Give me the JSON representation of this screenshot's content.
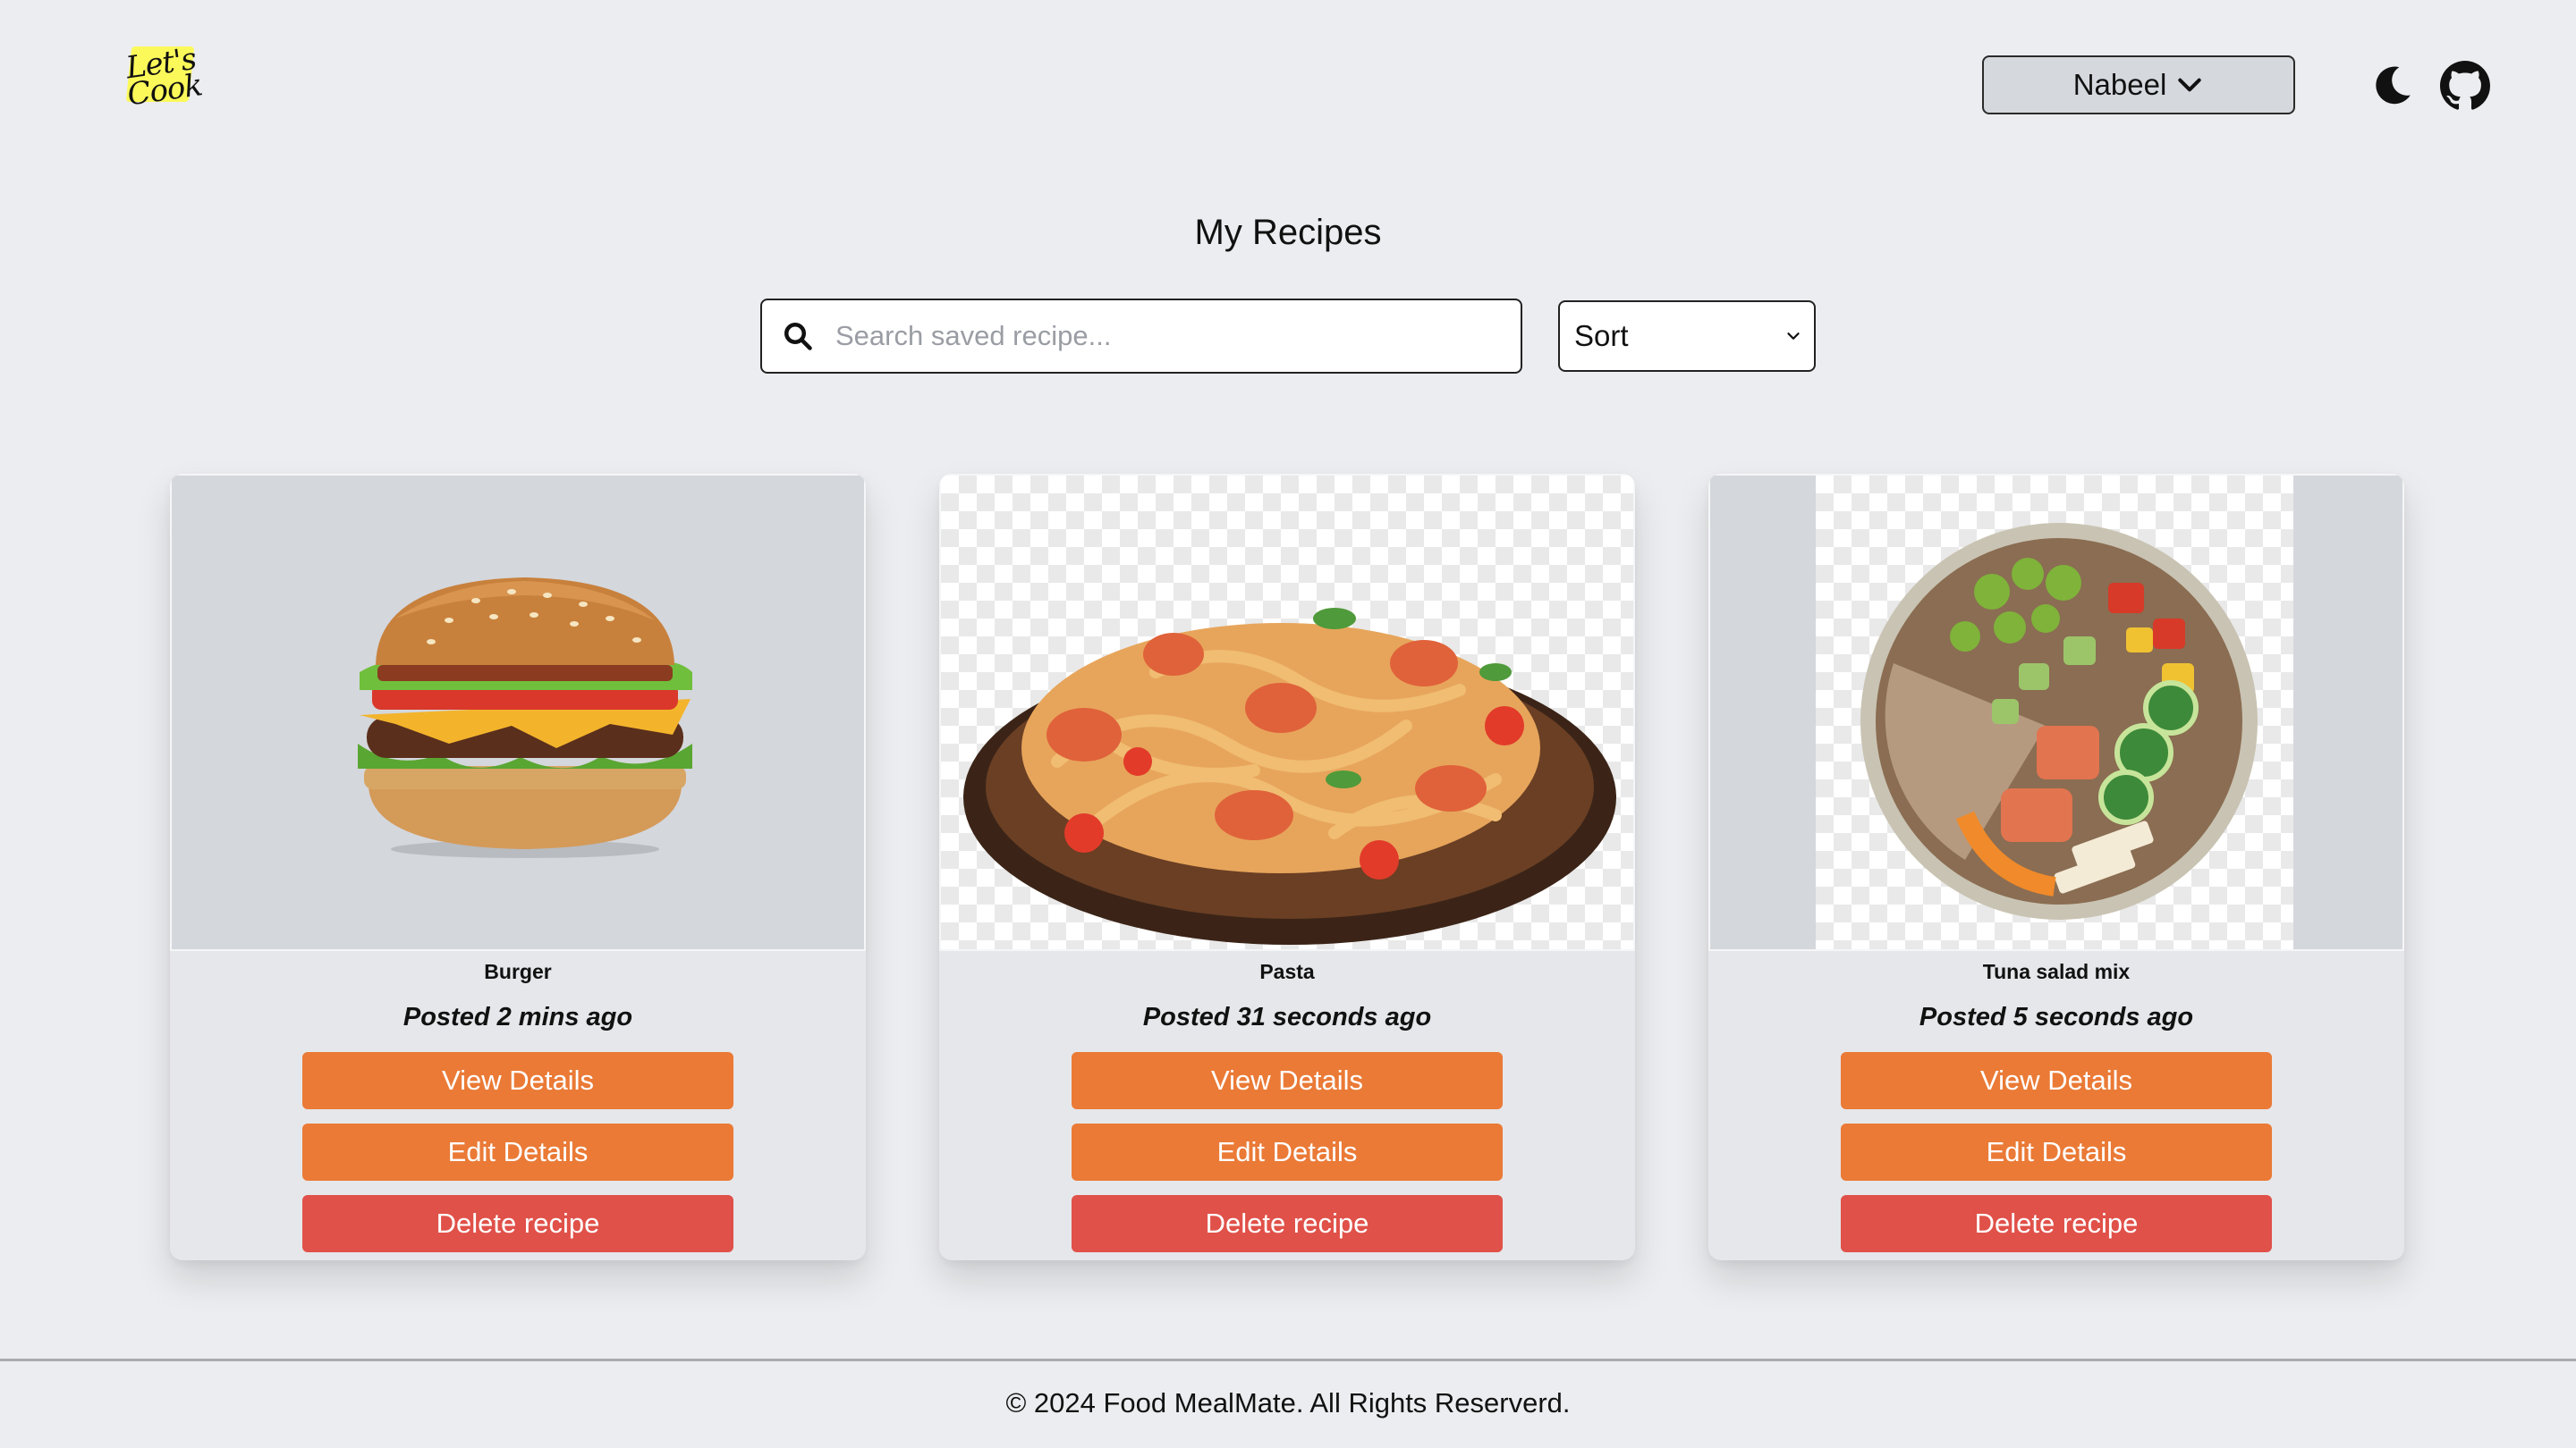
{
  "header": {
    "logo_text": "Let's Cook",
    "user_name": "Nabeel"
  },
  "main": {
    "title": "My Recipes",
    "search_placeholder": "Search saved recipe...",
    "sort_label": "Sort"
  },
  "recipes": [
    {
      "name": "Burger",
      "posted": "Posted 2 mins ago",
      "view_label": "View Details",
      "edit_label": "Edit Details",
      "delete_label": "Delete recipe"
    },
    {
      "name": "Pasta",
      "posted": "Posted 31 seconds ago",
      "view_label": "View Details",
      "edit_label": "Edit Details",
      "delete_label": "Delete recipe"
    },
    {
      "name": "Tuna salad mix",
      "posted": "Posted 5 seconds ago",
      "view_label": "View Details",
      "edit_label": "Edit Details",
      "delete_label": "Delete recipe"
    }
  ],
  "footer": {
    "text": "© 2024 Food MealMate. All Rights Reserverd."
  },
  "colors": {
    "background": "#ecedf0",
    "primary_button": "#ea7a36",
    "danger_button": "#e05149"
  }
}
